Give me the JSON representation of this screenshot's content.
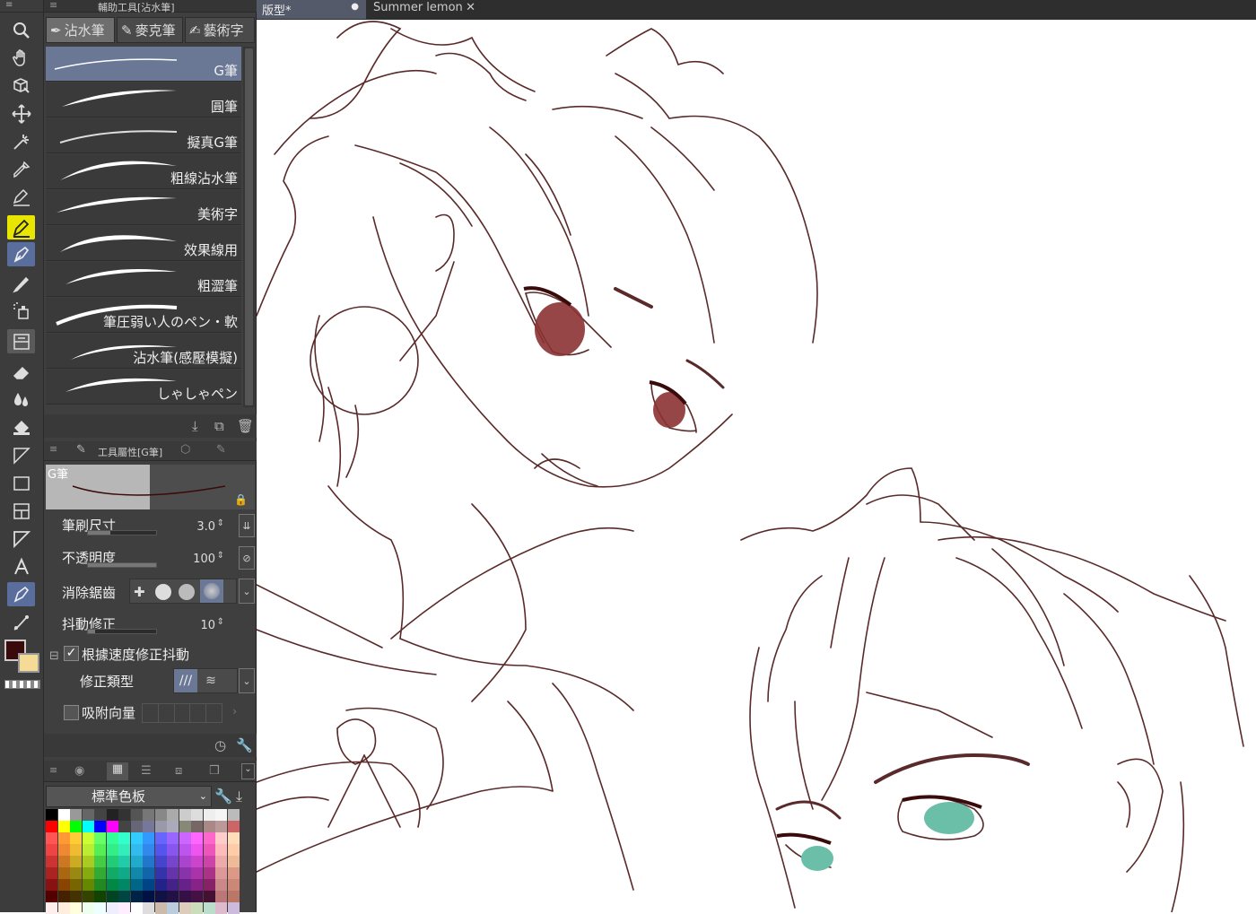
{
  "doc_tabs": [
    {
      "label": "版型*",
      "close": "●"
    },
    {
      "label": "Summer lemon",
      "close": "✕"
    }
  ],
  "sub_tool_panel": {
    "title": "輔助工具[沾水筆]",
    "tabs": [
      "沾水筆",
      "麥克筆",
      "藝術字"
    ],
    "brushes": [
      "G筆",
      "圓筆",
      "擬真G筆",
      "粗線沾水筆",
      "美術字",
      "效果線用",
      "粗澀筆",
      "筆圧弱い人のペン・軟",
      "沾水筆(感壓模擬)",
      "しゃしゃペン"
    ]
  },
  "tool_property": {
    "title": "工具屬性[G筆]",
    "preview_label": "G筆",
    "brush_size": {
      "label": "筆刷尺寸",
      "value": "3.0"
    },
    "opacity": {
      "label": "不透明度",
      "value": "100"
    },
    "antialias": {
      "label": "消除鋸齒"
    },
    "stabilization": {
      "label": "抖動修正",
      "value": "10"
    },
    "speed_stab": {
      "label": "根據速度修正抖動"
    },
    "correction_type": {
      "label": "修正類型"
    },
    "snap": {
      "label": "吸附向量"
    }
  },
  "palette": {
    "name": "標準色板"
  },
  "colors": {
    "main": "#3a0b0b",
    "sub": "#f5dc96",
    "line": "#5a2a2a",
    "eye_red": "#8b3232",
    "eye_green": "#6bbea8"
  }
}
